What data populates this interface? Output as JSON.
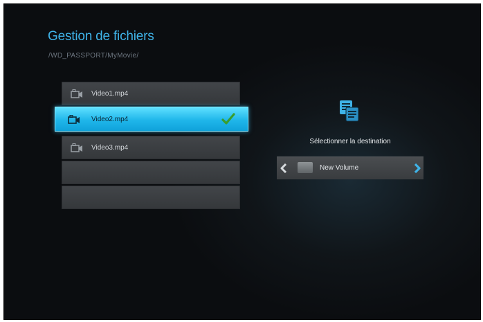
{
  "header": {
    "title": "Gestion de fichiers",
    "path": "/WD_PASSPORT/MyMovie/"
  },
  "files": [
    {
      "name": "Video1.mp4",
      "icon": "video-camera-icon",
      "selected": false
    },
    {
      "name": "Video2.mp4",
      "icon": "video-camera-icon",
      "selected": true
    },
    {
      "name": "Video3.mp4",
      "icon": "video-camera-icon",
      "selected": false
    }
  ],
  "destination": {
    "icon": "copy-files-icon",
    "label": "Sélectionner la destination",
    "volume_name": "New Volume",
    "volume_icon": "drive-icon"
  },
  "colors": {
    "accent": "#3fb3e8",
    "selected_row": "#1fb6ea",
    "check": "#3a9d2e"
  }
}
